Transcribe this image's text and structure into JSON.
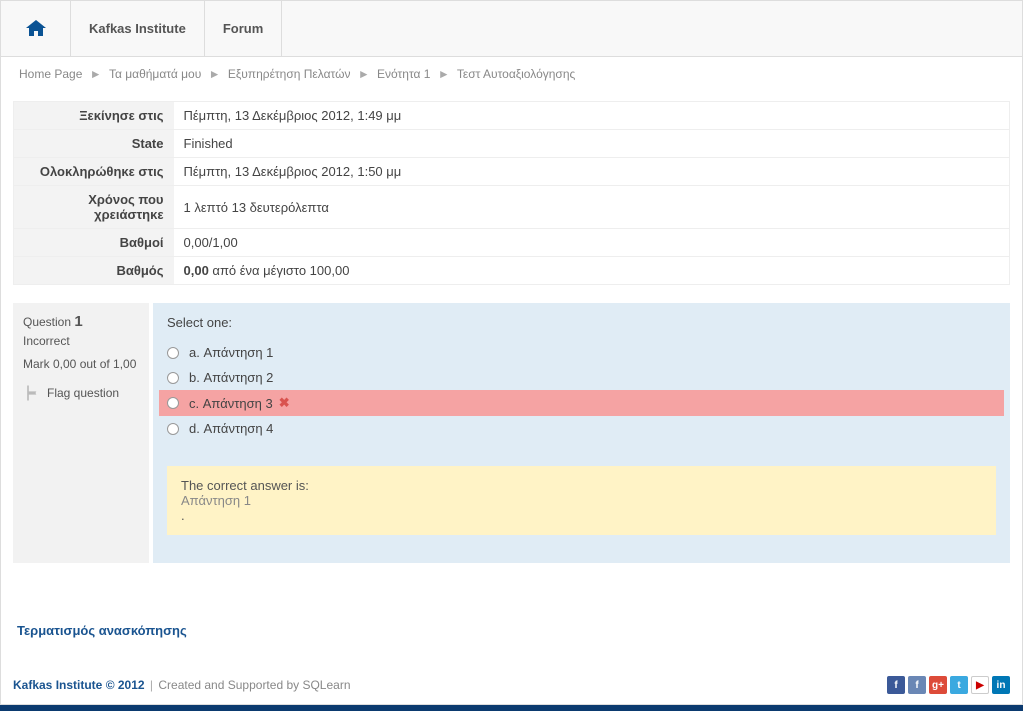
{
  "nav": {
    "institute": "Kafkas Institute",
    "forum": "Forum"
  },
  "breadcrumbs": [
    "Home Page",
    "Τα μαθήματά μου",
    "Εξυπηρέτηση Πελατών",
    "Ενότητα 1",
    "Τεστ Αυτοαξιολόγησης"
  ],
  "summary": {
    "rows": [
      {
        "label": "Ξεκίνησε στις",
        "value": "Πέμπτη, 13 Δεκέμβριος 2012, 1:49 μμ"
      },
      {
        "label": "State",
        "value": "Finished"
      },
      {
        "label": "Ολοκληρώθηκε στις",
        "value": "Πέμπτη, 13 Δεκέμβριος 2012, 1:50 μμ"
      },
      {
        "label": "Χρόνος που χρειάστηκε",
        "value": "1 λεπτό 13 δευτερόλεπτα"
      },
      {
        "label": "Βαθμοί",
        "value": "0,00/1,00"
      },
      {
        "label": "Βαθμός",
        "value_bold": "0,00",
        "value_rest": " από ένα μέγιστο 100,00"
      }
    ]
  },
  "question": {
    "label": "Question",
    "number": "1",
    "status": "Incorrect",
    "mark": "Mark 0,00 out of 1,00",
    "flag": "Flag question",
    "prompt": "Select one:",
    "answers": [
      {
        "letter": "a.",
        "text": "Απάντηση 1",
        "selected": false,
        "incorrect": false
      },
      {
        "letter": "b.",
        "text": "Απάντηση 2",
        "selected": false,
        "incorrect": false
      },
      {
        "letter": "c.",
        "text": "Απάντηση 3",
        "selected": true,
        "incorrect": true
      },
      {
        "letter": "d.",
        "text": "Απάντηση 4",
        "selected": false,
        "incorrect": false
      }
    ],
    "feedback": {
      "label": "The correct answer is:",
      "answer": "Απάντηση 1",
      "trailing": "."
    }
  },
  "finish_review": "Τερματισμός ανασκόπησης",
  "footer": {
    "brand": "Kafkas Institute © 2012",
    "credit": "Created and Supported by SQLearn"
  }
}
